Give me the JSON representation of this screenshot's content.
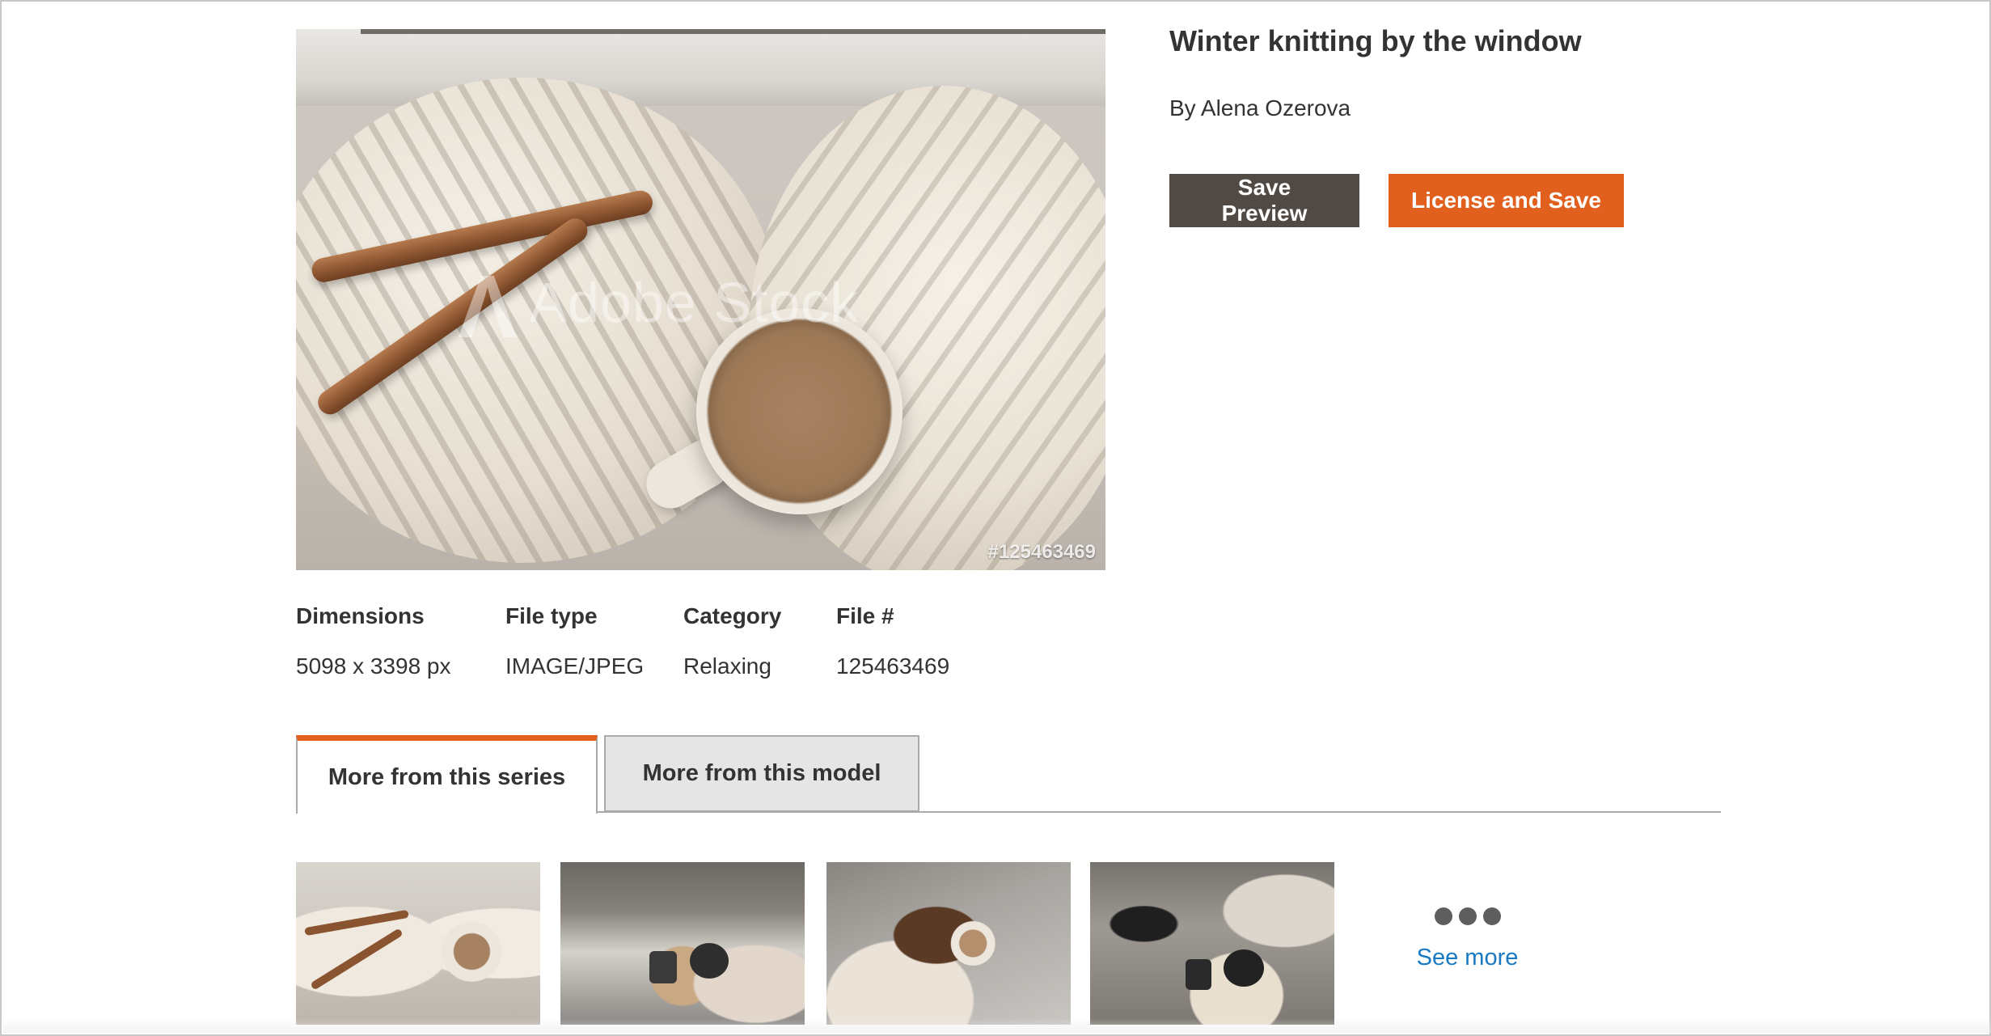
{
  "image": {
    "title": "Winter knitting by the window",
    "author": "By Alena Ozerova",
    "watermark_text": "Adobe Stock",
    "id_overlay": "#125463469"
  },
  "actions": {
    "save_preview": "Save Preview",
    "license_and_save": "License and Save"
  },
  "colors": {
    "primary_button": "#514943",
    "accent_button": "#e2601e",
    "link": "#1979c3",
    "active_tab_accent": "#e2601e"
  },
  "metadata": [
    {
      "label": "Dimensions",
      "value": "5098 x 3398 px"
    },
    {
      "label": "File type",
      "value": "IMAGE/JPEG"
    },
    {
      "label": "Category",
      "value": "Relaxing"
    },
    {
      "label": "File #",
      "value": "125463469"
    }
  ],
  "tabs": [
    {
      "label": "More from this series",
      "active": true
    },
    {
      "label": "More from this model",
      "active": false
    }
  ],
  "related": {
    "see_more_label": "See more",
    "see_more_icon": "more-dots-icon"
  }
}
